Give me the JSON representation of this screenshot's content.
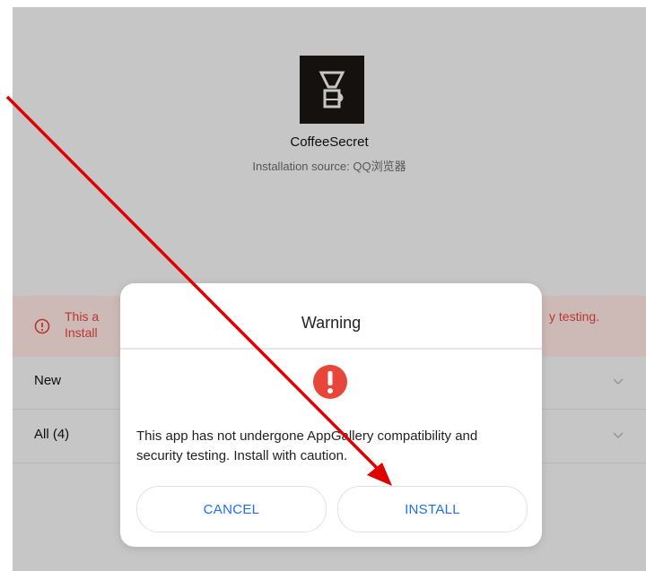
{
  "app": {
    "name": "CoffeeSecret",
    "installation_source": "Installation source: QQ浏览器"
  },
  "banner": {
    "text_start": "This a",
    "text_line2": "Install",
    "text_end": "y testing."
  },
  "list": {
    "rows": [
      {
        "label": "New"
      },
      {
        "label": "All (4)"
      }
    ]
  },
  "dialog": {
    "title": "Warning",
    "message": "This app has not undergone AppGallery compatibility and security testing. Install with caution.",
    "cancel_label": "CANCEL",
    "install_label": "INSTALL"
  },
  "icons": {
    "app_icon": "coffee-dripper-icon",
    "banner_icon": "warning-circle-icon",
    "dialog_icon": "exclamation-icon",
    "row_icon": "chevron-down-icon"
  },
  "colors": {
    "accent_blue": "#1f6fe0",
    "warning_red": "#e0443a",
    "annotation_red": "#e00000"
  }
}
